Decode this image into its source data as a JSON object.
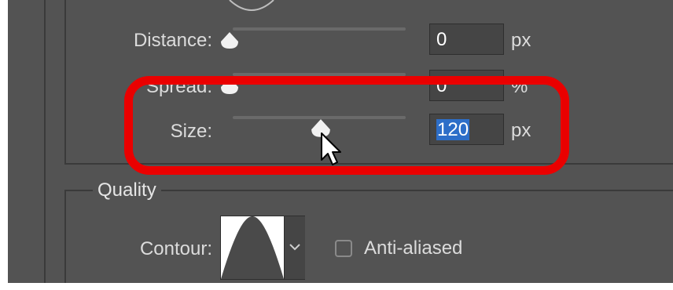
{
  "structure": {
    "distance_label": "Distance:",
    "distance_value": "0",
    "distance_unit": "px",
    "spread_label": "Spread:",
    "spread_value": "0",
    "spread_unit": "%",
    "size_label": "Size:",
    "size_value": "120",
    "size_unit": "px"
  },
  "quality": {
    "title": "Quality",
    "contour_label": "Contour:",
    "antialiased_label": "Anti-aliased",
    "antialiased_checked": false
  },
  "colors": {
    "panel_bg": "#535353",
    "highlight_ring": "#ea0000",
    "selection": "#2d6ec8"
  },
  "icons": [
    "slider-thumb-icon",
    "cursor-arrow-icon",
    "chevron-down-icon",
    "contour-curve-icon"
  ]
}
